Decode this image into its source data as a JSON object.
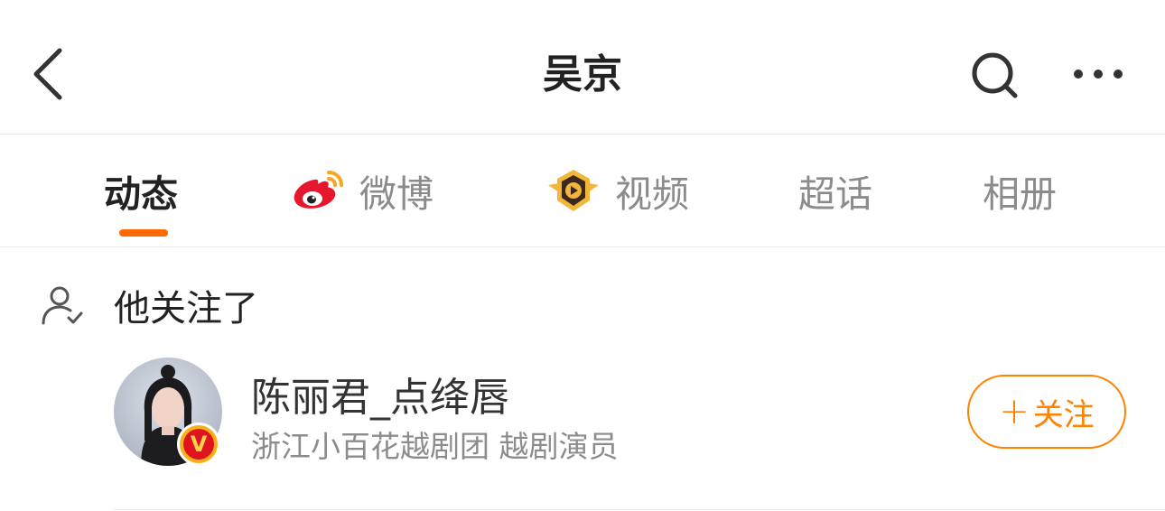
{
  "header": {
    "title": "吴京",
    "icons": {
      "back": "back-arrow-icon",
      "search": "search-icon",
      "more": "more-dots-icon"
    }
  },
  "tabs": [
    {
      "label": "动态",
      "active": true
    },
    {
      "label": "微博",
      "icon": "weibo-logo-icon"
    },
    {
      "label": "视频",
      "icon": "video-play-badge-icon"
    },
    {
      "label": "超话"
    },
    {
      "label": "相册"
    }
  ],
  "colors": {
    "accent": "#ff6a00",
    "follow": "#ff8200",
    "verified_badge": "#e0141e"
  },
  "following_section": {
    "icon": "user-check-icon",
    "title": "他关注了",
    "users": [
      {
        "name": "陈丽君_点绛唇",
        "description": "浙江小百花越剧团 越剧演员",
        "verified_badge": "V",
        "follow_label": "关注",
        "follow_icon": "+"
      }
    ]
  }
}
